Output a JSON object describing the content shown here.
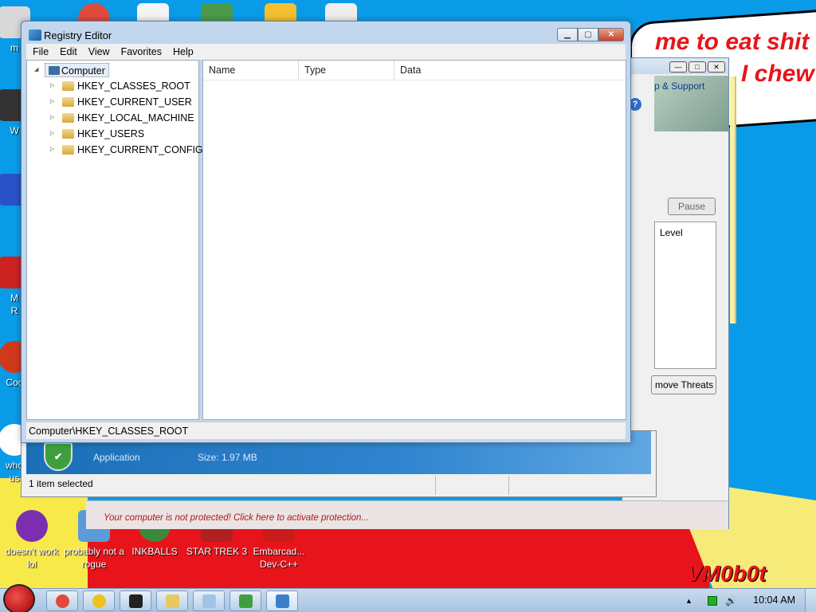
{
  "wallpaper": {
    "cloud_line1": "me to eat shit",
    "cloud_line2": "I chew",
    "signature": "VM0b0t"
  },
  "desktop_icons": [
    {
      "label": "m",
      "color": "#d8d8d8"
    },
    {
      "label": "W",
      "color": "#333333"
    },
    {
      "label": "",
      "color": "#2a52c8"
    },
    {
      "label": "M\nR",
      "color": "#cc2222"
    },
    {
      "label": "Coc",
      "color": "#d03a1a"
    },
    {
      "label": "who\nus",
      "color": "#ffffff"
    },
    {
      "label": "doesn't work lol",
      "color": "#7b2fb0"
    },
    {
      "label": "probably not a rogue",
      "color": "#5a9bd8"
    },
    {
      "label": "INKBALLS",
      "color": "#3a8a3a"
    },
    {
      "label": "STAR TREK 3",
      "color": "#b02020"
    },
    {
      "label": "Embarcad... Dev-C++",
      "color": "#c81c1c"
    }
  ],
  "background_window": {
    "help_support": "p & Support",
    "pause_button": "Pause",
    "level_header": "Level",
    "remove_button": "move Threats",
    "app_label": "Application",
    "size_label": "Size: 1.97 MB",
    "status_text": "1 item selected",
    "warning": "Your computer is not protected! Click here to activate protection..."
  },
  "regedit": {
    "title": "Registry Editor",
    "menu": [
      "File",
      "Edit",
      "View",
      "Favorites",
      "Help"
    ],
    "tree_root": "Computer",
    "hives": [
      "HKEY_CLASSES_ROOT",
      "HKEY_CURRENT_USER",
      "HKEY_LOCAL_MACHINE",
      "HKEY_USERS",
      "HKEY_CURRENT_CONFIG"
    ],
    "columns": [
      "Name",
      "Type",
      "Data"
    ],
    "status_path": "Computer\\HKEY_CLASSES_ROOT"
  },
  "taskbar": {
    "clock": "10:04 AM",
    "buttons": [
      {
        "icon": "chrome-icon",
        "color": "#e04a3a"
      },
      {
        "icon": "sun-icon",
        "color": "#f0c020"
      },
      {
        "icon": "7zip-icon",
        "color": "#222222"
      },
      {
        "icon": "explorer-icon",
        "color": "#e8c860"
      },
      {
        "icon": "notepad-icon",
        "color": "#9fc4e8"
      },
      {
        "icon": "shield-icon",
        "color": "#3f9f3f"
      },
      {
        "icon": "regedit-icon",
        "color": "#3a80c8"
      }
    ]
  }
}
